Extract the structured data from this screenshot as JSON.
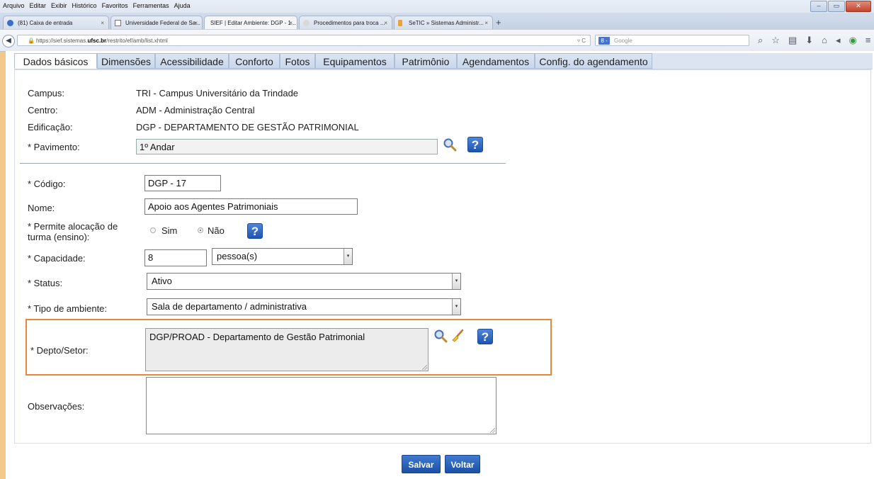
{
  "browser": {
    "menu": [
      "Arquivo",
      "Editar",
      "Exibir",
      "Histórico",
      "Favoritos",
      "Ferramentas",
      "Ajuda"
    ],
    "tabs": [
      {
        "label": "(81) Caixa de entrada",
        "icon_color": "#3b6fc7"
      },
      {
        "label": "Universidade Federal de Sa...",
        "icon_color": "#ffffff"
      },
      {
        "label": "SIEF | Editar Ambiente: DGP - 1...",
        "icon_color": "#cfd8e6"
      },
      {
        "label": "Procedimentos para troca ...",
        "icon_color": "#d9d9d9"
      },
      {
        "label": "SeTIC » Sistemas Administr...",
        "icon_color": "#e8a33a"
      }
    ],
    "new_tab": "+",
    "url_prefix": "https://sief.sistemas.",
    "url_domain": "ufsc.br",
    "url_path": "/restrito/ef/amb/list.xhtml",
    "search_placeholder": "Google",
    "search_engine_badge": "8 -"
  },
  "app_tabs": [
    {
      "label": "Dados básicos",
      "active": true
    },
    {
      "label": "Dimensões"
    },
    {
      "label": "Acessibilidade"
    },
    {
      "label": "Conforto"
    },
    {
      "label": "Fotos"
    },
    {
      "label": "Equipamentos"
    },
    {
      "label": "Patrimônio"
    },
    {
      "label": "Agendamentos"
    },
    {
      "label": "Config. do agendamento"
    }
  ],
  "form": {
    "campus_label": "Campus:",
    "campus_value": "TRI - Campus Universitário da Trindade",
    "centro_label": "Centro:",
    "centro_value": "ADM - Administração Central",
    "edificacao_label": "Edificação:",
    "edificacao_value": "DGP - DEPARTAMENTO DE GESTÃO PATRIMONIAL",
    "pavimento_label": "* Pavimento:",
    "pavimento_value": "1º Andar",
    "codigo_label": "* Código:",
    "codigo_value": "DGP - 17",
    "nome_label": "Nome:",
    "nome_value": "Apoio aos Agentes Patrimoniais",
    "permite_label_1": "* Permite alocação de",
    "permite_label_2": "turma (ensino):",
    "sim_label": "Sim",
    "nao_label": "Não",
    "capacidade_label": "* Capacidade:",
    "capacidade_value": "8",
    "capacidade_unit": "pessoa(s)",
    "status_label": "* Status:",
    "status_value": "Ativo",
    "tipo_label": "* Tipo de ambiente:",
    "tipo_value": "Sala de departamento / administrativa",
    "depto_label": "* Depto/Setor:",
    "depto_value": "DGP/PROAD - Departamento de Gestão Patrimonial",
    "obs_label": "Observações:",
    "obs_value": "",
    "help_glyph": "?"
  },
  "actions": {
    "save": "Salvar",
    "back": "Voltar"
  },
  "colors": {
    "highlight": "#e8873a",
    "button": "#2a62bd"
  }
}
